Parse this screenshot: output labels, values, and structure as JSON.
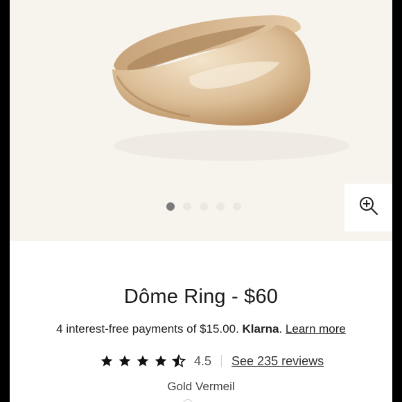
{
  "product": {
    "title": "Dôme Ring - $60",
    "installments_text": "4 interest-free payments of $15.00.",
    "klarna_label": "Klarna",
    "klarna_suffix": ".",
    "learn_more_label": "Learn more",
    "rating_value": "4.5",
    "rating_stars": 4.5,
    "reviews_link": "See 235 reviews",
    "variant": "Gold Vermeil"
  },
  "gallery": {
    "image_count": 5,
    "active_index": 0,
    "zoom_icon": "zoom-in-icon"
  },
  "colors": {
    "hero_background": "#f7f4ee",
    "active_dot": "#7a7a7a",
    "inactive_dot": "#ece8e1",
    "star": "#111111",
    "text": "#1a1a1a"
  }
}
